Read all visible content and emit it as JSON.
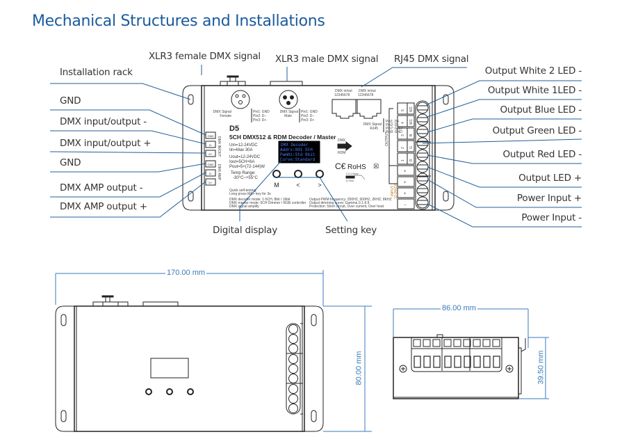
{
  "title": "Mechanical Structures and Installations",
  "top_labels": {
    "xlr3_female": "XLR3 female DMX signal",
    "xlr3_male": "XLR3 male DMX signal",
    "rj45": "RJ45 DMX signal"
  },
  "left_labels": [
    "Installation rack",
    "GND",
    "DMX input/output -",
    "DMX input/output +",
    "GND",
    "DMX AMP output -",
    "DMX AMP output +"
  ],
  "right_labels": [
    "Output White 2 LED -",
    "Output White 1LED -",
    "Output Blue LED -",
    "Output Green LED -",
    "Output Red LED -",
    "Output LED +",
    "Power Input +",
    "Power Input -"
  ],
  "bottom_labels": {
    "digital_display": "Digital display",
    "setting_key": "Setting key"
  },
  "device": {
    "model": "D5",
    "name": "5CH DMX512 & RDM Decoder / Master",
    "specs": [
      "Uin=12-24VDC",
      "Iin=Max 30A",
      "Uout=12-24VDC",
      "Iout=5CH×6A",
      "Pout=5×(72-144)W"
    ],
    "temp_label": "Temp Range:",
    "temp_value": "-30°C~+55°C",
    "oled_lines": [
      "DMX Decoder",
      "Addrs:001    5CH",
      "PwmHz:Std   8bit",
      "Curve:Standard"
    ],
    "keys": [
      "M",
      "<",
      ">"
    ],
    "xlr_female": {
      "label1": "DMX Signal",
      "label2": "Female",
      "pins": [
        "Pin1: GND",
        "Pin2: D−",
        "Pin3: D+"
      ]
    },
    "xlr_male": {
      "label1": "DMX Signal",
      "label2": "Male",
      "pins": [
        "Pin1: GND",
        "Pin2: D−",
        "Pin3: D+"
      ]
    },
    "rj45_port_label": "DMX in/out",
    "rj45_pin_numbers": "12345678",
    "rj45_signal": {
      "label1": "DMX Signal",
      "label2": "RJ45",
      "pins": [
        "Pin1: D+",
        "Pin2: D−",
        "Pin7: GND",
        "Pin8: GND"
      ]
    },
    "dmx_in_terminals": [
      "GND",
      "D-",
      "D+"
    ],
    "dmx_in_group": "DMX IN/OUT",
    "dmx_amp_terminals": [
      "GND",
      "D-",
      "D+"
    ],
    "dmx_amp_group": "DMX AMP",
    "output_channels": [
      {
        "num": "5",
        "color": "W2"
      },
      {
        "num": "4",
        "color": "W1"
      },
      {
        "num": "3",
        "color": "B"
      },
      {
        "num": "2",
        "color": "G"
      },
      {
        "num": "1",
        "color": "R"
      }
    ],
    "output_group": "OUTPUT",
    "input_group": "INPUT",
    "input_voltage": "12-24VDC",
    "plus_signs": [
      "+",
      "+",
      "+"
    ],
    "minus_sign": "−",
    "dmx_arrow_top": "DMX",
    "dmx_arrow_bottom": "RDM",
    "cert": "RoHS",
    "quick_test": [
      "Quick self-testing:",
      "Long press M&> key for 3s"
    ],
    "notes_left": [
      "DMX decoder mode: 1-5CH, 8bit / 16bit",
      "DMX master mode: 5CH Dimmer / RGB controller",
      "DMX signal amplify"
    ],
    "notes_right": [
      "Output PWM frequency: 250HZ, 500HZ, 2KHZ, 8KHZ",
      "Output dimming curve: Gamma 0.1-9.9",
      "Protection: Short circuit, Over current, Over heat"
    ],
    "wire_spec": [
      "0.2-4.0mm²",
      "6-7mm"
    ]
  },
  "dimensions": {
    "length": "170.00 mm",
    "height": "80.00 mm",
    "width": "86.00 mm",
    "depth": "39.50 mm"
  },
  "colors": {
    "title": "#1a5a9c",
    "leader_line": "#1f5f99",
    "dimension": "#3a7ab8"
  }
}
